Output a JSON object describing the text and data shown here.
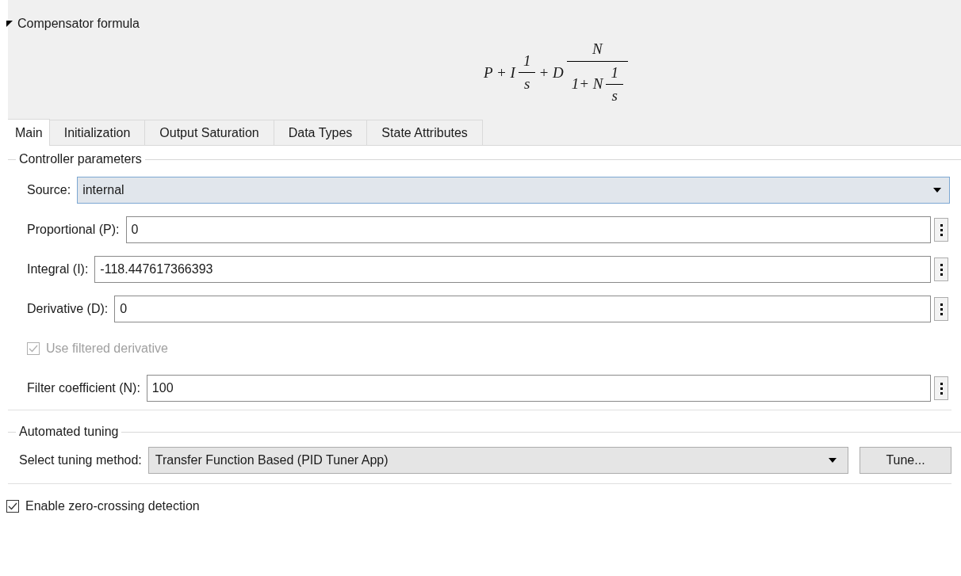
{
  "formula_section": {
    "title": "Compensator formula",
    "expanded": true,
    "formula": [
      {
        "kind": "text",
        "text": "P + I"
      },
      {
        "kind": "frac",
        "num": [
          {
            "kind": "text",
            "text": "1"
          }
        ],
        "den": [
          {
            "kind": "text",
            "text": "s"
          }
        ]
      },
      {
        "kind": "text",
        "text": "+ D"
      },
      {
        "kind": "frac",
        "num": [
          {
            "kind": "text",
            "text": "N"
          }
        ],
        "den": [
          {
            "kind": "text",
            "text": "1+ N"
          },
          {
            "kind": "frac",
            "num": [
              {
                "kind": "text",
                "text": "1"
              }
            ],
            "den": [
              {
                "kind": "text",
                "text": "s"
              }
            ]
          }
        ]
      }
    ]
  },
  "tabs": [
    {
      "label": "Main",
      "selected": true
    },
    {
      "label": "Initialization",
      "selected": false
    },
    {
      "label": "Output Saturation",
      "selected": false
    },
    {
      "label": "Data Types",
      "selected": false
    },
    {
      "label": "State Attributes",
      "selected": false
    }
  ],
  "controller_parameters": {
    "title": "Controller parameters",
    "rows": [
      {
        "kind": "dropdown",
        "label": "Source:",
        "value": "internal"
      },
      {
        "kind": "field",
        "label": "Proportional (P):",
        "value": "0"
      },
      {
        "kind": "field",
        "label": "Integral (I):",
        "value": "-118.447617366393"
      },
      {
        "kind": "field",
        "label": "Derivative (D):",
        "value": "0"
      },
      {
        "kind": "checkbox",
        "label": "Use filtered derivative",
        "checked": true,
        "disabled": true
      },
      {
        "kind": "field",
        "label": "Filter coefficient (N):",
        "value": "100"
      }
    ]
  },
  "automated_tuning": {
    "title": "Automated tuning",
    "label": "Select tuning method:",
    "value": "Transfer Function Based (PID Tuner App)",
    "button": "Tune..."
  },
  "zero_crossing": {
    "label": "Enable zero-crossing detection",
    "checked": true,
    "disabled": false
  }
}
